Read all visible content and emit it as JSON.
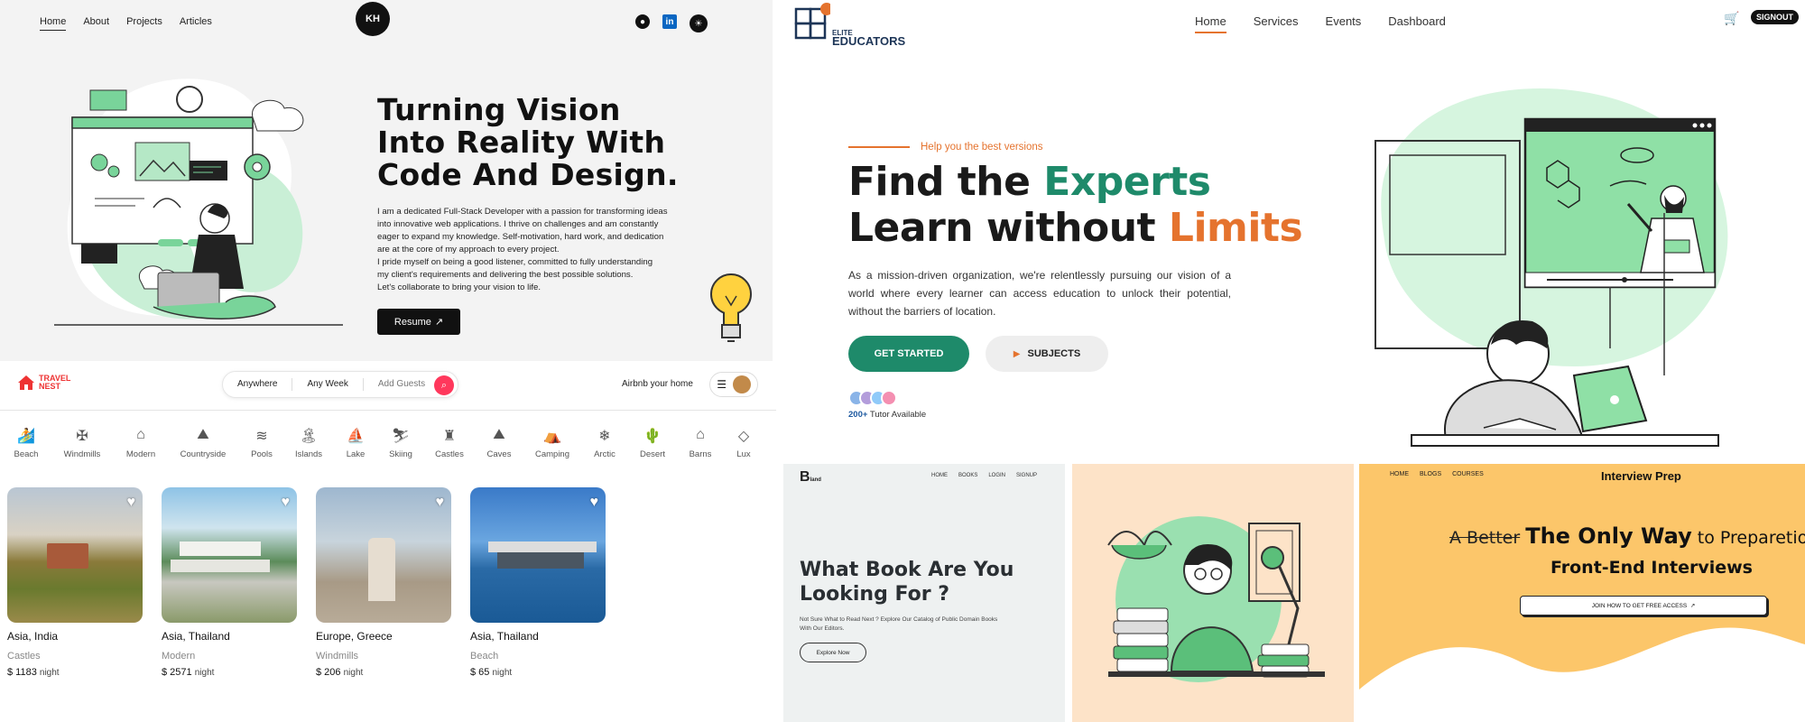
{
  "portfolio": {
    "nav": [
      "Home",
      "About",
      "Projects",
      "Articles"
    ],
    "logo": "KH",
    "social": {
      "github": "github-icon",
      "linkedin": "linkedin-icon",
      "theme": "theme-toggle-icon"
    },
    "headline": [
      "Turning Vision",
      "Into Reality With",
      "Code And Design."
    ],
    "bio": [
      "I am a dedicated Full-Stack Developer with a passion for transforming ideas",
      "into innovative web applications. I thrive on challenges and am constantly",
      "eager to expand my knowledge. Self-motivation, hard work, and dedication",
      "are at the core of my approach to every project.",
      "I pride myself on being a good listener, committed to fully understanding",
      "my client's requirements and delivering the best possible solutions.",
      "Let's collaborate to bring your vision to life."
    ],
    "resume": "Resume",
    "accent": "#79d49a"
  },
  "travel": {
    "brand": [
      "TRAVEL",
      "NEST"
    ],
    "search": {
      "where": "Anywhere",
      "when": "Any Week",
      "guests": "Add Guests"
    },
    "host": "Airbnb your home",
    "categories": [
      {
        "label": "Beach",
        "icon": "🏄"
      },
      {
        "label": "Windmills",
        "icon": "✠"
      },
      {
        "label": "Modern",
        "icon": "⌂"
      },
      {
        "label": "Countryside",
        "icon": "⛰"
      },
      {
        "label": "Pools",
        "icon": "≋"
      },
      {
        "label": "Islands",
        "icon": "🏝"
      },
      {
        "label": "Lake",
        "icon": "⛵"
      },
      {
        "label": "Skiing",
        "icon": "⛷"
      },
      {
        "label": "Castles",
        "icon": "♜"
      },
      {
        "label": "Caves",
        "icon": "⛰"
      },
      {
        "label": "Camping",
        "icon": "⛺"
      },
      {
        "label": "Arctic",
        "icon": "❄"
      },
      {
        "label": "Desert",
        "icon": "🌵"
      },
      {
        "label": "Barns",
        "icon": "⌂"
      },
      {
        "label": "Lux",
        "icon": "◇"
      }
    ],
    "listings": [
      {
        "location": "Asia, India",
        "type": "Castles",
        "price": "$ 1183",
        "unit": "night"
      },
      {
        "location": "Asia, Thailand",
        "type": "Modern",
        "price": "$ 2571",
        "unit": "night"
      },
      {
        "location": "Europe, Greece",
        "type": "Windmills",
        "price": "$ 206",
        "unit": "night"
      },
      {
        "location": "Asia, Thailand",
        "type": "Beach",
        "price": "$ 65",
        "unit": "night"
      }
    ],
    "accent": "#ff385c"
  },
  "educators": {
    "brand": [
      "ELITE",
      "EDUCATORS"
    ],
    "nav": [
      "Home",
      "Services",
      "Events",
      "Dashboard"
    ],
    "signout": "SIGNOUT",
    "tagline": "Help you the best versions",
    "headline": {
      "a": "Find the ",
      "b": "Experts",
      "c": "Learn without ",
      "d": "Limits"
    },
    "description": "As a mission-driven organization, we're relentlessly pursuing our vision of a world where every learner can access education to unlock their potential, without the barriers of location.",
    "get_started": "GET STARTED",
    "subjects": "SUBJECTS",
    "tutors_count": "200+",
    "tutors_label": " Tutor Available",
    "green": "#1e8a6a",
    "orange": "#e5732e"
  },
  "books": {
    "logo": "B",
    "logo_suffix": "land",
    "nav": [
      "HOME",
      "BOOKS",
      "LOGIN",
      "SIGNUP"
    ],
    "headline": "What Book Are You Looking For ?",
    "sub": "Not Sure What to Read Next ? Explore Our Catalog of Public Domain Books With Our Editors.",
    "explore": "Explore Now"
  },
  "interview": {
    "nav": [
      "HOME",
      "BLOGS",
      "COURSES"
    ],
    "brand": "Interview Prep",
    "struck": "A Better",
    "bold": "The Only Way",
    "rest": " to Preparetion",
    "line2": "Front-End Interviews",
    "join": "JOIN HOW TO GET FREE ACCESS"
  }
}
